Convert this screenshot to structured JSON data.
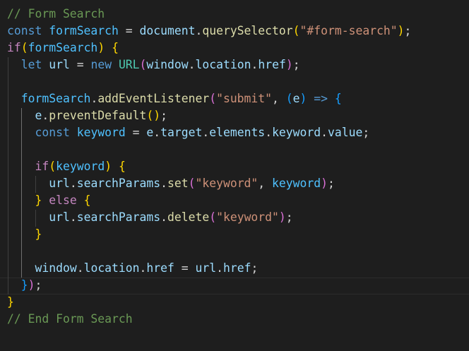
{
  "editor": {
    "theme_colors": {
      "background": "#1e1e1e",
      "comment": "#6a9955",
      "keyword": "#569cd6",
      "control": "#c586c0",
      "variable": "#9cdcfe",
      "function": "#dcdcaa",
      "string": "#ce9178",
      "class": "#4ec9b0",
      "bracket_level1": "#ffd700",
      "bracket_level2": "#da70d6",
      "bracket_level3": "#179fff"
    },
    "lines": [
      [
        {
          "t": "// Form Search",
          "c": "comment"
        }
      ],
      [
        {
          "t": "const",
          "c": "keyword"
        },
        {
          "t": " ",
          "c": "punct"
        },
        {
          "t": "formSearch",
          "c": "const"
        },
        {
          "t": " = ",
          "c": "punct"
        },
        {
          "t": "document",
          "c": "var"
        },
        {
          "t": ".",
          "c": "punct"
        },
        {
          "t": "querySelector",
          "c": "func"
        },
        {
          "t": "(",
          "c": "b1"
        },
        {
          "t": "\"#form-search\"",
          "c": "string"
        },
        {
          "t": ")",
          "c": "b1"
        },
        {
          "t": ";",
          "c": "punct"
        }
      ],
      [
        {
          "t": "if",
          "c": "control"
        },
        {
          "t": "(",
          "c": "b1"
        },
        {
          "t": "formSearch",
          "c": "const"
        },
        {
          "t": ")",
          "c": "b1"
        },
        {
          "t": " ",
          "c": "punct"
        },
        {
          "t": "{",
          "c": "b1"
        }
      ],
      [
        {
          "t": "  ",
          "c": "punct"
        },
        {
          "t": "let",
          "c": "keyword"
        },
        {
          "t": " ",
          "c": "punct"
        },
        {
          "t": "url",
          "c": "var"
        },
        {
          "t": " = ",
          "c": "punct"
        },
        {
          "t": "new",
          "c": "keyword"
        },
        {
          "t": " ",
          "c": "punct"
        },
        {
          "t": "URL",
          "c": "class"
        },
        {
          "t": "(",
          "c": "b2"
        },
        {
          "t": "window",
          "c": "var"
        },
        {
          "t": ".",
          "c": "punct"
        },
        {
          "t": "location",
          "c": "var"
        },
        {
          "t": ".",
          "c": "punct"
        },
        {
          "t": "href",
          "c": "var"
        },
        {
          "t": ")",
          "c": "b2"
        },
        {
          "t": ";",
          "c": "punct"
        }
      ],
      [],
      [
        {
          "t": "  ",
          "c": "punct"
        },
        {
          "t": "formSearch",
          "c": "const"
        },
        {
          "t": ".",
          "c": "punct"
        },
        {
          "t": "addEventListener",
          "c": "func"
        },
        {
          "t": "(",
          "c": "b2"
        },
        {
          "t": "\"submit\"",
          "c": "string"
        },
        {
          "t": ", ",
          "c": "punct"
        },
        {
          "t": "(",
          "c": "b3"
        },
        {
          "t": "e",
          "c": "var"
        },
        {
          "t": ")",
          "c": "b3"
        },
        {
          "t": " ",
          "c": "punct"
        },
        {
          "t": "=>",
          "c": "keyword"
        },
        {
          "t": " ",
          "c": "punct"
        },
        {
          "t": "{",
          "c": "b3"
        }
      ],
      [
        {
          "t": "    ",
          "c": "punct"
        },
        {
          "t": "e",
          "c": "var"
        },
        {
          "t": ".",
          "c": "punct"
        },
        {
          "t": "preventDefault",
          "c": "func"
        },
        {
          "t": "(",
          "c": "b1"
        },
        {
          "t": ")",
          "c": "b1"
        },
        {
          "t": ";",
          "c": "punct"
        }
      ],
      [
        {
          "t": "    ",
          "c": "punct"
        },
        {
          "t": "const",
          "c": "keyword"
        },
        {
          "t": " ",
          "c": "punct"
        },
        {
          "t": "keyword",
          "c": "const"
        },
        {
          "t": " = ",
          "c": "punct"
        },
        {
          "t": "e",
          "c": "var"
        },
        {
          "t": ".",
          "c": "punct"
        },
        {
          "t": "target",
          "c": "var"
        },
        {
          "t": ".",
          "c": "punct"
        },
        {
          "t": "elements",
          "c": "var"
        },
        {
          "t": ".",
          "c": "punct"
        },
        {
          "t": "keyword",
          "c": "var"
        },
        {
          "t": ".",
          "c": "punct"
        },
        {
          "t": "value",
          "c": "var"
        },
        {
          "t": ";",
          "c": "punct"
        }
      ],
      [],
      [
        {
          "t": "    ",
          "c": "punct"
        },
        {
          "t": "if",
          "c": "control"
        },
        {
          "t": "(",
          "c": "b1"
        },
        {
          "t": "keyword",
          "c": "const"
        },
        {
          "t": ")",
          "c": "b1"
        },
        {
          "t": " ",
          "c": "punct"
        },
        {
          "t": "{",
          "c": "b1"
        }
      ],
      [
        {
          "t": "      ",
          "c": "punct"
        },
        {
          "t": "url",
          "c": "var"
        },
        {
          "t": ".",
          "c": "punct"
        },
        {
          "t": "searchParams",
          "c": "var"
        },
        {
          "t": ".",
          "c": "punct"
        },
        {
          "t": "set",
          "c": "func"
        },
        {
          "t": "(",
          "c": "b2"
        },
        {
          "t": "\"keyword\"",
          "c": "string"
        },
        {
          "t": ", ",
          "c": "punct"
        },
        {
          "t": "keyword",
          "c": "const"
        },
        {
          "t": ")",
          "c": "b2"
        },
        {
          "t": ";",
          "c": "punct"
        }
      ],
      [
        {
          "t": "    ",
          "c": "punct"
        },
        {
          "t": "}",
          "c": "b1"
        },
        {
          "t": " ",
          "c": "punct"
        },
        {
          "t": "else",
          "c": "control"
        },
        {
          "t": " ",
          "c": "punct"
        },
        {
          "t": "{",
          "c": "b1"
        }
      ],
      [
        {
          "t": "      ",
          "c": "punct"
        },
        {
          "t": "url",
          "c": "var"
        },
        {
          "t": ".",
          "c": "punct"
        },
        {
          "t": "searchParams",
          "c": "var"
        },
        {
          "t": ".",
          "c": "punct"
        },
        {
          "t": "delete",
          "c": "func"
        },
        {
          "t": "(",
          "c": "b2"
        },
        {
          "t": "\"keyword\"",
          "c": "string"
        },
        {
          "t": ")",
          "c": "b2"
        },
        {
          "t": ";",
          "c": "punct"
        }
      ],
      [
        {
          "t": "    ",
          "c": "punct"
        },
        {
          "t": "}",
          "c": "b1"
        }
      ],
      [],
      [
        {
          "t": "    ",
          "c": "punct"
        },
        {
          "t": "window",
          "c": "var"
        },
        {
          "t": ".",
          "c": "punct"
        },
        {
          "t": "location",
          "c": "var"
        },
        {
          "t": ".",
          "c": "punct"
        },
        {
          "t": "href",
          "c": "var"
        },
        {
          "t": " = ",
          "c": "punct"
        },
        {
          "t": "url",
          "c": "var"
        },
        {
          "t": ".",
          "c": "punct"
        },
        {
          "t": "href",
          "c": "var"
        },
        {
          "t": ";",
          "c": "punct"
        }
      ],
      [
        {
          "t": "  ",
          "c": "punct"
        },
        {
          "t": "}",
          "c": "b3"
        },
        {
          "t": ")",
          "c": "b2"
        },
        {
          "t": ";",
          "c": "punct"
        }
      ],
      [
        {
          "t": "}",
          "c": "b1"
        }
      ],
      [
        {
          "t": "// End Form Search",
          "c": "comment"
        }
      ]
    ]
  }
}
